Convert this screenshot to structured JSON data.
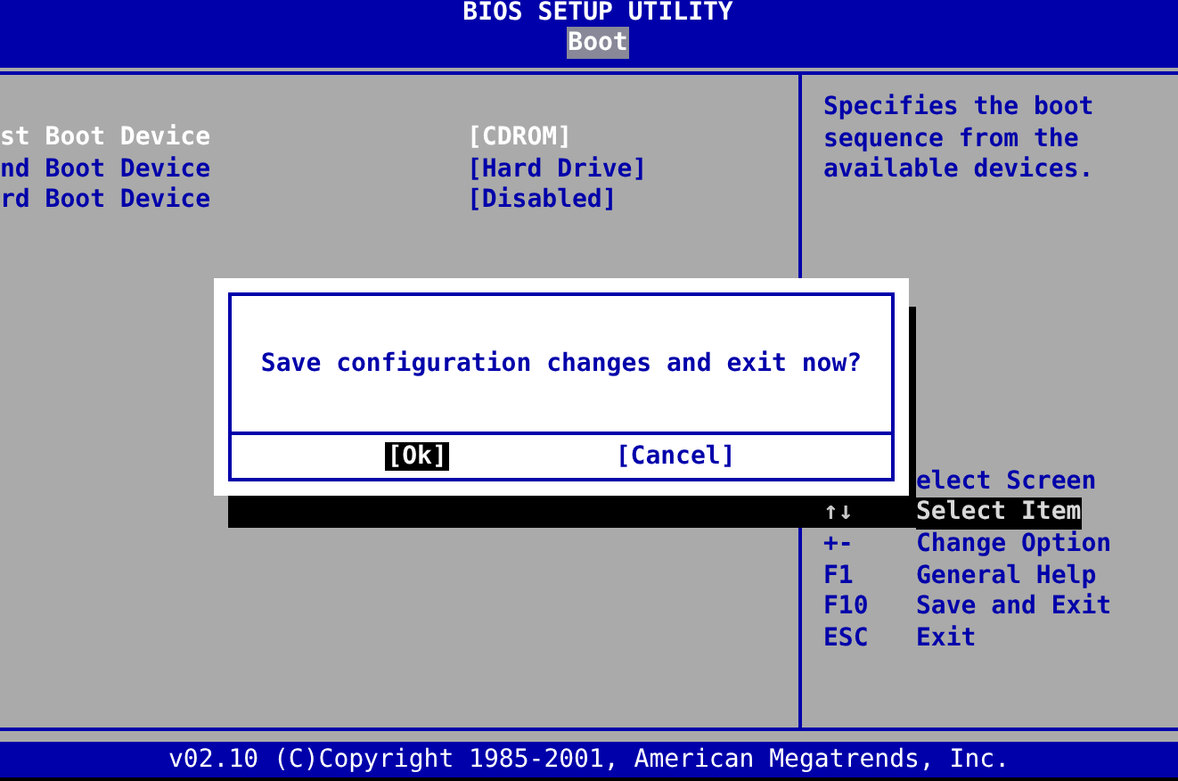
{
  "header": {
    "title": "BIOS SETUP UTILITY",
    "tabs": [
      {
        "label": "Boot",
        "selected": true
      }
    ]
  },
  "boot_devices": [
    {
      "label": "st Boot Device",
      "value": "[CDROM]",
      "selected": true
    },
    {
      "label": "nd Boot Device",
      "value": "[Hard Drive]",
      "selected": false
    },
    {
      "label": "rd Boot Device",
      "value": "[Disabled]",
      "selected": false
    }
  ],
  "help_text": "Specifies the boot sequence from the available devices.",
  "legend": [
    {
      "action": "elect Screen",
      "covered": false
    },
    {
      "key": "↑↓",
      "action": "Select Item",
      "covered": true
    },
    {
      "key": "+-",
      "action": "Change Option",
      "covered": false
    },
    {
      "key": "F1",
      "action": "General Help",
      "covered": false
    },
    {
      "key": "F10",
      "action": "Save and Exit",
      "covered": false
    },
    {
      "key": "ESC",
      "action": "Exit",
      "covered": false
    }
  ],
  "dialog": {
    "message": "Save configuration changes and exit now?",
    "buttons": [
      {
        "label": "[Ok]",
        "selected": true
      },
      {
        "label": "[Cancel]",
        "selected": false
      }
    ]
  },
  "status_bar": "v02.10 (C)Copyright 1985-2001, American Megatrends, Inc."
}
